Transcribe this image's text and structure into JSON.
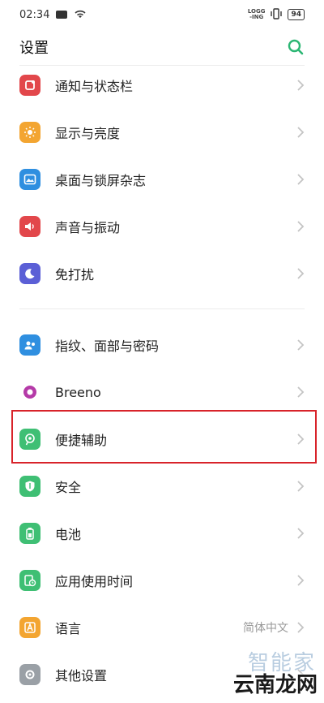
{
  "status_bar": {
    "time": "02:34",
    "logging": "LOGG\n-ING",
    "battery": "94"
  },
  "header": {
    "title": "设置"
  },
  "group1": [
    {
      "label": "通知与状态栏",
      "icon": "notification-icon",
      "color": "#e2474b"
    },
    {
      "label": "显示与亮度",
      "icon": "brightness-icon",
      "color": "#f3a531"
    },
    {
      "label": "桌面与锁屏杂志",
      "icon": "wallpaper-icon",
      "color": "#2f8fe0"
    },
    {
      "label": "声音与振动",
      "icon": "sound-icon",
      "color": "#e2474b"
    },
    {
      "label": "免打扰",
      "icon": "moon-icon",
      "color": "#5b5fd6"
    }
  ],
  "group2": [
    {
      "label": "指纹、面部与密码",
      "icon": "fingerprint-icon",
      "color": "#2f8fe0"
    },
    {
      "label": "Breeno",
      "icon": "breeno-icon",
      "color": "#b53aa8"
    },
    {
      "label": "便捷辅助",
      "icon": "assist-icon",
      "color": "#3fbf74"
    },
    {
      "label": "安全",
      "icon": "shield-icon",
      "color": "#3fbf74"
    },
    {
      "label": "电池",
      "icon": "battery-icon",
      "color": "#3fbf74"
    },
    {
      "label": "应用使用时间",
      "icon": "app-time-icon",
      "color": "#3fbf74"
    },
    {
      "label": "语言",
      "icon": "language-icon",
      "color": "#f3a531",
      "value": "简体中文"
    },
    {
      "label": "其他设置",
      "icon": "other-settings-icon",
      "color": "#9aa0a6"
    }
  ],
  "watermark": {
    "top": "智能家",
    "bottom": "云南龙网"
  },
  "accent": "#2bb673",
  "highlight_color": "#d8232a"
}
